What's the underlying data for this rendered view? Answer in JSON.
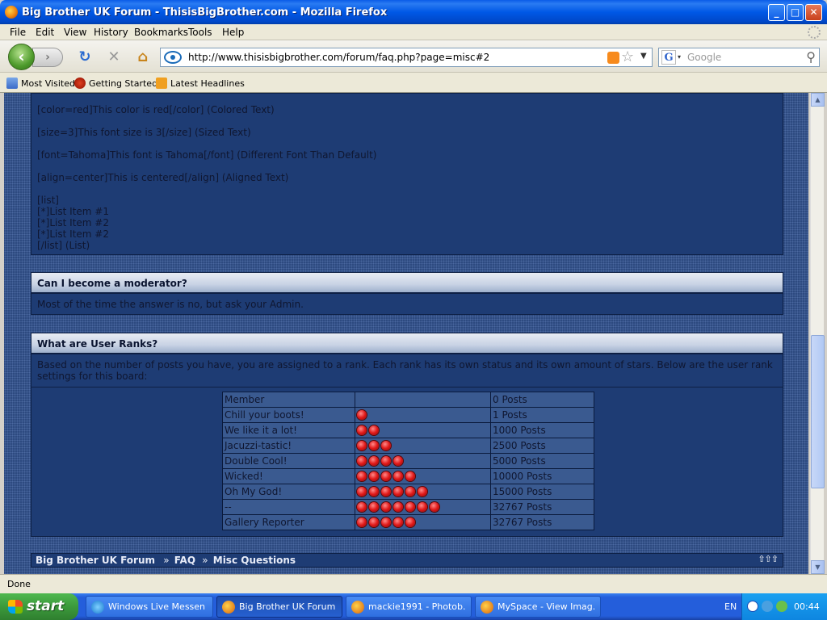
{
  "window": {
    "title": "Big Brother UK Forum - ThisisBigBrother.com - Mozilla Firefox",
    "minimize": "_",
    "maximize": "□",
    "close": "✕"
  },
  "menu": [
    "File",
    "Edit",
    "View",
    "History",
    "Bookmarks",
    "Tools",
    "Help"
  ],
  "nav": {
    "url": "http://www.thisisbigbrother.com/forum/faq.php?page=misc#2",
    "search_placeholder": "Google"
  },
  "bookmarks": [
    "Most Visited",
    "Getting Started",
    "Latest Headlines"
  ],
  "content": {
    "bbcode_lines": [
      "[color=red]This color is red[/color]   (Colored Text)",
      "[size=3]This font size is 3[/size]   (Sized Text)",
      "[font=Tahoma]This font is Tahoma[/font]   (Different Font Than Default)",
      "[align=center]This is centered[/align]   (Aligned Text)",
      "[list]",
      "[*]List Item #1",
      "[*]List Item #2",
      "[*]List Item #2",
      "[/list]   (List)"
    ],
    "q1": {
      "title": "Can I become a moderator?",
      "answer": "Most of the time the answer is no, but ask your Admin."
    },
    "q2": {
      "title": "What are User Ranks?",
      "answer": "Based on the number of posts you have, you are assigned to a rank. Each rank has its own status and its own amount of stars. Below are the user rank settings for this board:"
    },
    "ranks": [
      {
        "name": "Member",
        "stars": 0,
        "posts": "0 Posts"
      },
      {
        "name": "Chill your boots!",
        "stars": 1,
        "posts": "1 Posts"
      },
      {
        "name": "We like it a lot!",
        "stars": 2,
        "posts": "1000 Posts"
      },
      {
        "name": "Jacuzzi-tastic!",
        "stars": 3,
        "posts": "2500 Posts"
      },
      {
        "name": "Double Cool!",
        "stars": 4,
        "posts": "5000 Posts"
      },
      {
        "name": "Wicked!",
        "stars": 5,
        "posts": "10000 Posts"
      },
      {
        "name": "Oh My God!",
        "stars": 6,
        "posts": "15000 Posts"
      },
      {
        "name": "--",
        "stars": 7,
        "posts": "32767 Posts"
      },
      {
        "name": "Gallery Reporter",
        "stars": 5,
        "posts": "32767 Posts"
      }
    ],
    "breadcrumb": {
      "forum": "Big Brother UK Forum",
      "sep1": "»",
      "faq": "FAQ",
      "sep2": "»",
      "misc": "Misc Questions"
    },
    "up_arrows": "⇧⇧⇧"
  },
  "status": "Done",
  "taskbar": {
    "start": "start",
    "tasks": [
      "Windows Live Messen...",
      "Big Brother UK Forum...",
      "mackie1991 - Photob...",
      "MySpace - View Imag..."
    ],
    "lang": "EN",
    "clock": "00:44"
  }
}
